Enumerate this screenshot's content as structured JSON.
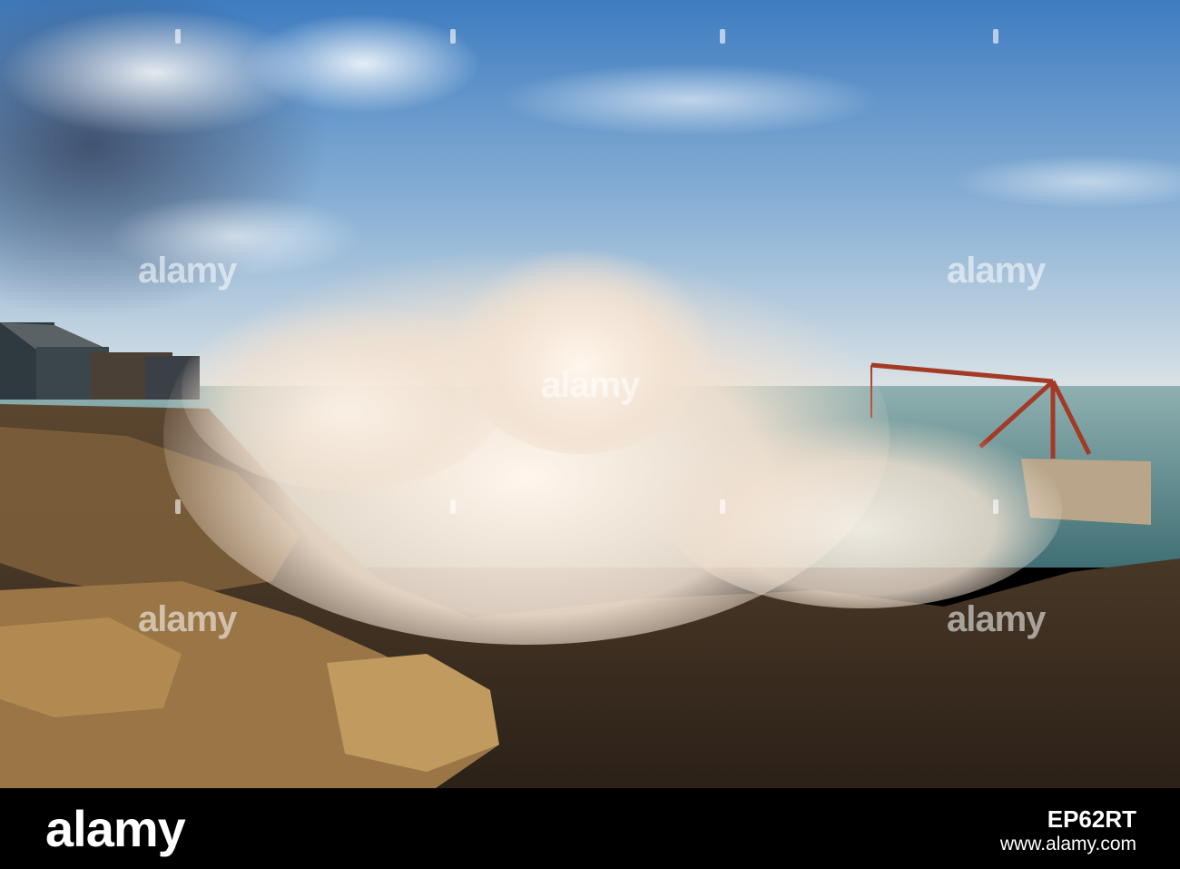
{
  "watermark": {
    "brand": "alamy",
    "image_id": "EP62RT",
    "site": "www.alamy.com"
  },
  "scene": {
    "subject": "waves-crashing-on-rocky-shore",
    "colors": {
      "sky_top": "#4a86c4",
      "sky_horizon": "#d6dfe4",
      "sea": "#4a7c82",
      "rock": "#6b5236",
      "rock_lit": "#b08a52",
      "spray": "#f3e9de",
      "crane": "#a33a26"
    }
  }
}
